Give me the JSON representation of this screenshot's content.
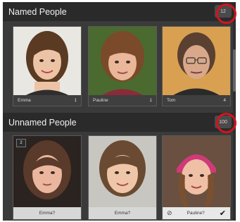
{
  "named_section": {
    "title": "Named People",
    "count": "12",
    "people": [
      {
        "name": "Emma",
        "count": "1"
      },
      {
        "name": "Pauline",
        "count": "1"
      },
      {
        "name": "Tom",
        "count": "4"
      }
    ]
  },
  "unnamed_section": {
    "title": "Unnamed People",
    "count": "100",
    "suggestions": [
      {
        "index": "2",
        "label": "Emma?"
      },
      {
        "label": "Emma?"
      },
      {
        "label": "Pauline?"
      }
    ]
  },
  "colors": {
    "highlight": "#d3141c",
    "panel_bg": "#3a3a3a",
    "header_bg": "#2a2a2a"
  },
  "icons": {
    "reject": "reject-icon",
    "confirm": "check-icon"
  }
}
